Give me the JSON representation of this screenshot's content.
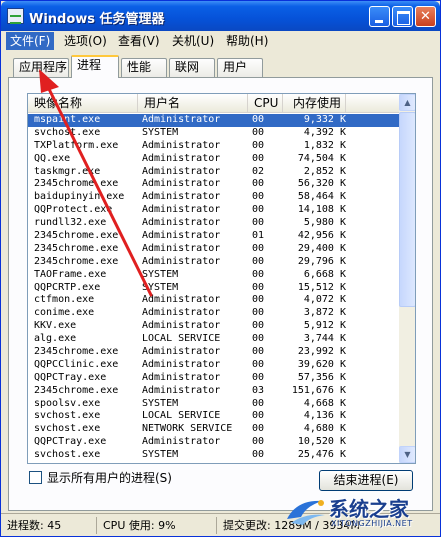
{
  "window": {
    "title": "Windows 任务管理器"
  },
  "menu": [
    "文件(F)",
    "选项(O)",
    "查看(V)",
    "关机(U)",
    "帮助(H)"
  ],
  "tabs": [
    "应用程序",
    "进程",
    "性能",
    "联网",
    "用户"
  ],
  "selected_tab": "进程",
  "columns": [
    "映像名称",
    "用户名",
    "CPU",
    "内存使用"
  ],
  "processes": [
    {
      "name": "mspaint.exe",
      "user": "Administrator",
      "cpu": "00",
      "mem": "9,332 K"
    },
    {
      "name": "svchost.exe",
      "user": "SYSTEM",
      "cpu": "00",
      "mem": "4,392 K"
    },
    {
      "name": "TXPlatform.exe",
      "user": "Administrator",
      "cpu": "00",
      "mem": "1,832 K"
    },
    {
      "name": "QQ.exe",
      "user": "Administrator",
      "cpu": "00",
      "mem": "74,504 K"
    },
    {
      "name": "taskmgr.exe",
      "user": "Administrator",
      "cpu": "02",
      "mem": "2,852 K"
    },
    {
      "name": "2345chrome.exe",
      "user": "Administrator",
      "cpu": "00",
      "mem": "56,320 K"
    },
    {
      "name": "baidupinyin.exe",
      "user": "Administrator",
      "cpu": "00",
      "mem": "58,464 K"
    },
    {
      "name": "QQProtect.exe",
      "user": "Administrator",
      "cpu": "00",
      "mem": "14,108 K"
    },
    {
      "name": "rundll32.exe",
      "user": "Administrator",
      "cpu": "00",
      "mem": "5,980 K"
    },
    {
      "name": "2345chrome.exe",
      "user": "Administrator",
      "cpu": "01",
      "mem": "42,956 K"
    },
    {
      "name": "2345chrome.exe",
      "user": "Administrator",
      "cpu": "00",
      "mem": "29,400 K"
    },
    {
      "name": "2345chrome.exe",
      "user": "Administrator",
      "cpu": "00",
      "mem": "29,796 K"
    },
    {
      "name": "TAOFrame.exe",
      "user": "SYSTEM",
      "cpu": "00",
      "mem": "6,668 K"
    },
    {
      "name": "QQPCRTP.exe",
      "user": "SYSTEM",
      "cpu": "00",
      "mem": "15,512 K"
    },
    {
      "name": "ctfmon.exe",
      "user": "Administrator",
      "cpu": "00",
      "mem": "4,072 K"
    },
    {
      "name": "conime.exe",
      "user": "Administrator",
      "cpu": "00",
      "mem": "3,872 K"
    },
    {
      "name": "KKV.exe",
      "user": "Administrator",
      "cpu": "00",
      "mem": "5,912 K"
    },
    {
      "name": "alg.exe",
      "user": "LOCAL SERVICE",
      "cpu": "00",
      "mem": "3,744 K"
    },
    {
      "name": "2345chrome.exe",
      "user": "Administrator",
      "cpu": "00",
      "mem": "23,992 K"
    },
    {
      "name": "QQPCClinic.exe",
      "user": "Administrator",
      "cpu": "00",
      "mem": "39,620 K"
    },
    {
      "name": "QQPCTray.exe",
      "user": "Administrator",
      "cpu": "00",
      "mem": "57,356 K"
    },
    {
      "name": "2345chrome.exe",
      "user": "Administrator",
      "cpu": "03",
      "mem": "151,676 K"
    },
    {
      "name": "spoolsv.exe",
      "user": "SYSTEM",
      "cpu": "00",
      "mem": "4,668 K"
    },
    {
      "name": "svchost.exe",
      "user": "LOCAL SERVICE",
      "cpu": "00",
      "mem": "4,136 K"
    },
    {
      "name": "svchost.exe",
      "user": "NETWORK SERVICE",
      "cpu": "00",
      "mem": "4,680 K"
    },
    {
      "name": "QQPCTray.exe",
      "user": "Administrator",
      "cpu": "00",
      "mem": "10,520 K"
    },
    {
      "name": "svchost.exe",
      "user": "SYSTEM",
      "cpu": "00",
      "mem": "25,476 K"
    }
  ],
  "show_all_users_label": "显示所有用户的进程(S)",
  "end_process_label": "结束进程(E)",
  "status": {
    "process_count": "进程数: 45",
    "cpu_usage": "CPU 使用: 9%",
    "commit": "提交更改: 1289M / 3934M"
  },
  "watermark": {
    "text": "系统之家",
    "sub": "XITONGZHIJIA.NET"
  },
  "colors": {
    "titlebar": "#0652d8",
    "selection": "#316ac5",
    "annotation_arrow": "#e02020"
  }
}
